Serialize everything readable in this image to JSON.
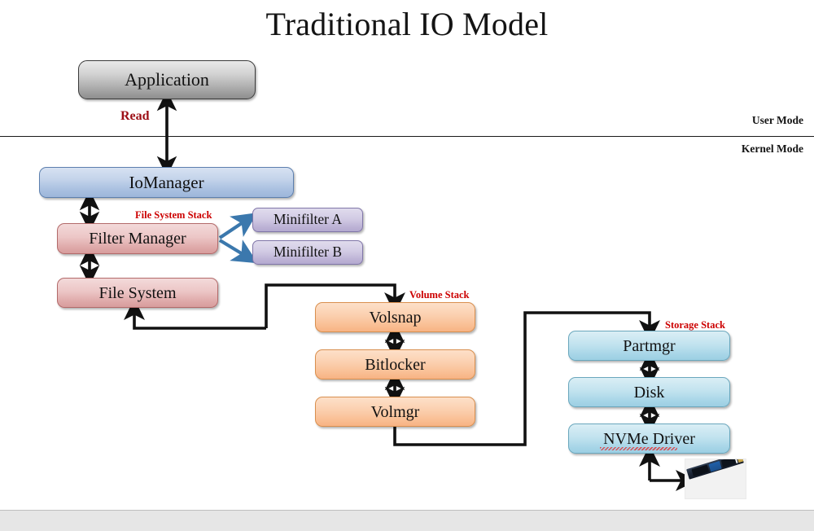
{
  "slide": {
    "title": "Traditional IO Model",
    "background_color": "#ffffff",
    "bottom_band_color": "#e6e6e6"
  },
  "mode_divider": {
    "user_mode_label": "User Mode",
    "kernel_mode_label": "Kernel Mode"
  },
  "labels": {
    "read": "Read",
    "read_color": "#9c0d14",
    "file_system_stack": "File System Stack",
    "volume_stack": "Volume Stack",
    "storage_stack": "Storage Stack",
    "stack_caption_color": "#cc0000"
  },
  "nodes": {
    "application": "Application",
    "iomanager": "IoManager",
    "filter_manager": "Filter Manager",
    "minifilter_a": "Minifilter A",
    "minifilter_b": "Minifilter B",
    "file_system": "File System",
    "volsnap": "Volsnap",
    "bitlocker": "Bitlocker",
    "volmgr": "Volmgr",
    "partmgr": "Partmgr",
    "disk": "Disk",
    "nvme_driver": "NVMe Driver"
  },
  "colors": {
    "application_fill": "#c8c8c8",
    "iomanager_fill": "#b8cbe6",
    "file_system_stack_fill": "#e7bdbd",
    "minifilter_fill": "#c8c0dd",
    "volume_stack_fill": "#fac69f",
    "storage_stack_fill": "#b4dcea",
    "connector_black": "#111111",
    "minifilter_arrow_blue": "#3b78ad"
  },
  "device": {
    "image_name": "nvme-m2-ssd-photo",
    "alt": "M.2 NVMe SSD"
  },
  "annotations": {
    "nvme_spellcheck_underline": true
  }
}
